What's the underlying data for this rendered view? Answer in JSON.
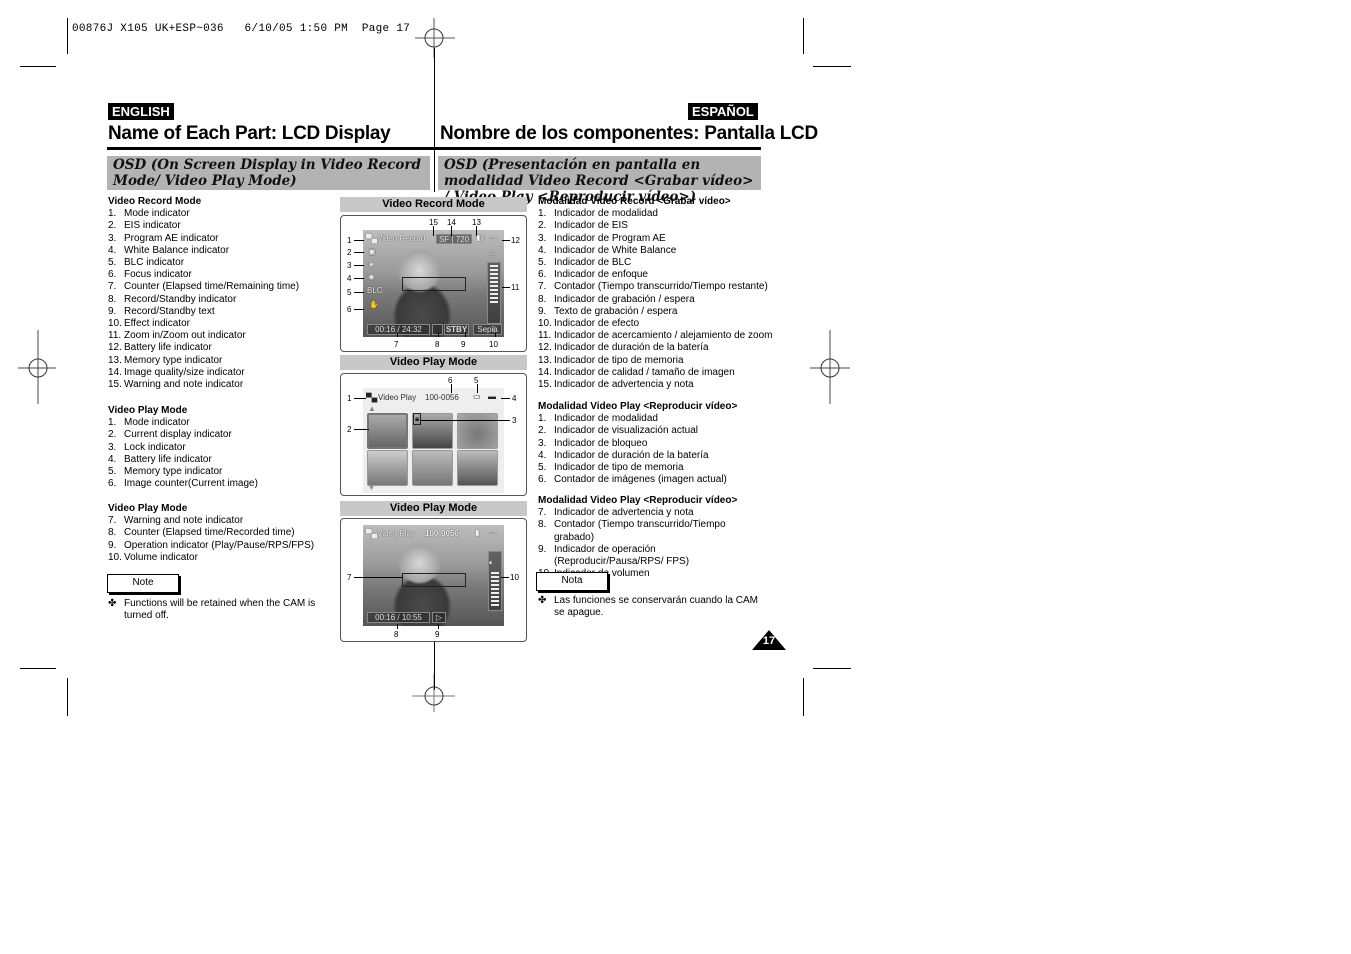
{
  "slug": "00876J X105 UK+ESP~036   6/10/05 1:50 PM  Page 17",
  "english": {
    "lang_tag": "ENGLISH",
    "title": "Name of Each Part: LCD Display",
    "osd_heading": "OSD (On Screen Display in Video Record Mode/ Video Play Mode)",
    "record_section": {
      "heading": "Video Record Mode",
      "items": [
        {
          "n": "1.",
          "t": "Mode indicator"
        },
        {
          "n": "2.",
          "t": "EIS indicator"
        },
        {
          "n": "3.",
          "t": "Program AE indicator"
        },
        {
          "n": "4.",
          "t": "White Balance indicator"
        },
        {
          "n": "5.",
          "t": "BLC indicator"
        },
        {
          "n": "6.",
          "t": "Focus indicator"
        },
        {
          "n": "7.",
          "t": "Counter (Elapsed time/Remaining time)"
        },
        {
          "n": "8.",
          "t": "Record/Standby indicator"
        },
        {
          "n": "9.",
          "t": "Record/Standby text"
        },
        {
          "n": "10.",
          "t": "Effect indicator"
        },
        {
          "n": "11.",
          "t": "Zoom in/Zoom out indicator"
        },
        {
          "n": "12.",
          "t": "Battery life indicator"
        },
        {
          "n": "13.",
          "t": "Memory type indicator"
        },
        {
          "n": "14.",
          "t": "Image quality/size indicator"
        },
        {
          "n": "15.",
          "t": "Warning and note indicator"
        }
      ]
    },
    "play_section_1": {
      "heading": "Video Play Mode",
      "items": [
        {
          "n": "1.",
          "t": "Mode indicator"
        },
        {
          "n": "2.",
          "t": "Current display indicator"
        },
        {
          "n": "3.",
          "t": "Lock indicator"
        },
        {
          "n": "4.",
          "t": "Battery life indicator"
        },
        {
          "n": "5.",
          "t": "Memory type indicator"
        },
        {
          "n": "6.",
          "t": "Image counter(Current image)"
        }
      ]
    },
    "play_section_2": {
      "heading": "Video Play Mode",
      "items": [
        {
          "n": "7.",
          "t": "Warning and note indicator"
        },
        {
          "n": "8.",
          "t": "Counter (Elapsed time/Recorded time)"
        },
        {
          "n": "9.",
          "t": "Operation indicator (Play/Pause/RPS/FPS)"
        },
        {
          "n": "10.",
          "t": "Volume indicator"
        }
      ]
    },
    "note_label": "Note",
    "note_bullet": "✤",
    "note_text": "Functions will be retained when the CAM is turned off."
  },
  "spanish": {
    "lang_tag": "ESPAÑOL",
    "title": "Nombre de los componentes: Pantalla LCD",
    "osd_heading": "OSD (Presentación en pantalla en modalidad Video Record <Grabar vídeo> / Video Play <Reproducir vídeo>)",
    "record_section": {
      "heading": "Modalidad Video Record <Grabar vídeo>",
      "items": [
        {
          "n": "1.",
          "t": "Indicador de modalidad"
        },
        {
          "n": "2.",
          "t": "Indicador de EIS"
        },
        {
          "n": "3.",
          "t": "Indicador de Program AE"
        },
        {
          "n": "4.",
          "t": "Indicador de White Balance"
        },
        {
          "n": "5.",
          "t": "Indicador de BLC"
        },
        {
          "n": "6.",
          "t": "Indicador de enfoque"
        },
        {
          "n": "7.",
          "t": "Contador (Tiempo transcurrido/Tiempo restante)"
        },
        {
          "n": "8.",
          "t": "Indicador de grabación / espera"
        },
        {
          "n": "9.",
          "t": "Texto de grabación / espera"
        },
        {
          "n": "10.",
          "t": "Indicador de efecto"
        },
        {
          "n": "11.",
          "t": "Indicador de acercamiento / alejamiento de zoom"
        },
        {
          "n": "12.",
          "t": "Indicador de duración de la batería"
        },
        {
          "n": "13.",
          "t": "Indicador de tipo de memoria"
        },
        {
          "n": "14.",
          "t": "Indicador de calidad / tamaño de imagen"
        },
        {
          "n": "15.",
          "t": "Indicador de advertencia y nota"
        }
      ]
    },
    "play_section_1": {
      "heading": "Modalidad Video Play <Reproducir vídeo>",
      "items": [
        {
          "n": "1.",
          "t": "Indicador de modalidad"
        },
        {
          "n": "2.",
          "t": "Indicador de visualización actual"
        },
        {
          "n": "3.",
          "t": "Indicador de bloqueo"
        },
        {
          "n": "4.",
          "t": "Indicador de duración de la batería"
        },
        {
          "n": "5.",
          "t": "Indicador de tipo de memoria"
        },
        {
          "n": "6.",
          "t": "Contador de imágenes (imagen actual)"
        }
      ]
    },
    "play_section_2": {
      "heading": "Modalidad Video Play <Reproducir vídeo>",
      "items": [
        {
          "n": "7.",
          "t": "Indicador de advertencia y nota"
        },
        {
          "n": "8.",
          "t": "Contador (Tiempo transcurrido/Tiempo grabado)"
        },
        {
          "n": "9.",
          "t": "Indicador de operación (Reproducir/Pausa/RPS/ FPS)"
        },
        {
          "n": "10.",
          "t": "Indicador de volumen"
        }
      ]
    },
    "note_label": "Nota",
    "note_bullet": "✤",
    "note_text": "Las funciones se conservarán cuando la CAM se apague."
  },
  "diagrams": {
    "record": {
      "label": "Video Record Mode",
      "osd_mode_text": "Video Record",
      "quality": "SF",
      "size": "720",
      "counter": "00:16 / 24:32",
      "standby_text": "STBY",
      "effect_text": "Sepia",
      "zoom_letter": "T",
      "callouts_left": [
        "1",
        "2",
        "3",
        "4",
        "5",
        "6"
      ],
      "callouts_top": [
        "15",
        "14",
        "13"
      ],
      "callouts_right": [
        "12",
        "11"
      ],
      "callouts_bottom": [
        "7",
        "8",
        "9",
        "10"
      ]
    },
    "play_thumbs": {
      "label": "Video Play Mode",
      "osd_mode_text": "Video Play",
      "image_counter": "100-0056",
      "callouts_left": [
        "1",
        "2"
      ],
      "callouts_top": [
        "6",
        "5"
      ],
      "callouts_right": [
        "4",
        "3"
      ]
    },
    "play_full": {
      "label": "Video Play Mode",
      "osd_mode_text": "Video Play",
      "image_counter": "100-0056",
      "counter": "00:16 / 10:55",
      "callouts_left": [
        "7"
      ],
      "callouts_right": [
        "10"
      ],
      "callouts_bottom": [
        "8",
        "9"
      ]
    }
  },
  "page_number": "17"
}
